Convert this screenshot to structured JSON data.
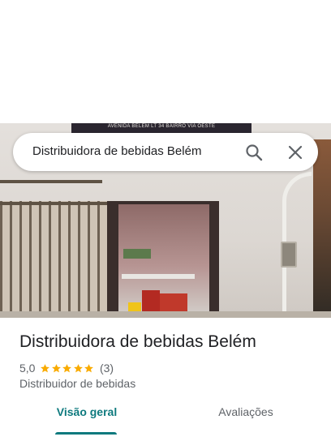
{
  "search": {
    "query": "Distribuidora de bebidas Belém",
    "search_icon": "search-icon",
    "close_icon": "close-icon"
  },
  "photo": {
    "sign_text": "AVENIDA BELEM LT 34 BAIRRO VIA OESTE"
  },
  "place": {
    "title": "Distribuidora de bebidas Belém",
    "rating": "5,0",
    "stars": 5,
    "review_count": "(3)",
    "category": "Distribuidor de bebidas"
  },
  "tabs": [
    {
      "label": "Visão geral",
      "selected": true
    },
    {
      "label": "Avaliações",
      "selected": false
    }
  ],
  "colors": {
    "accent": "#0e7a7e",
    "star": "#f9ab00",
    "secondary_text": "#5f6368"
  }
}
